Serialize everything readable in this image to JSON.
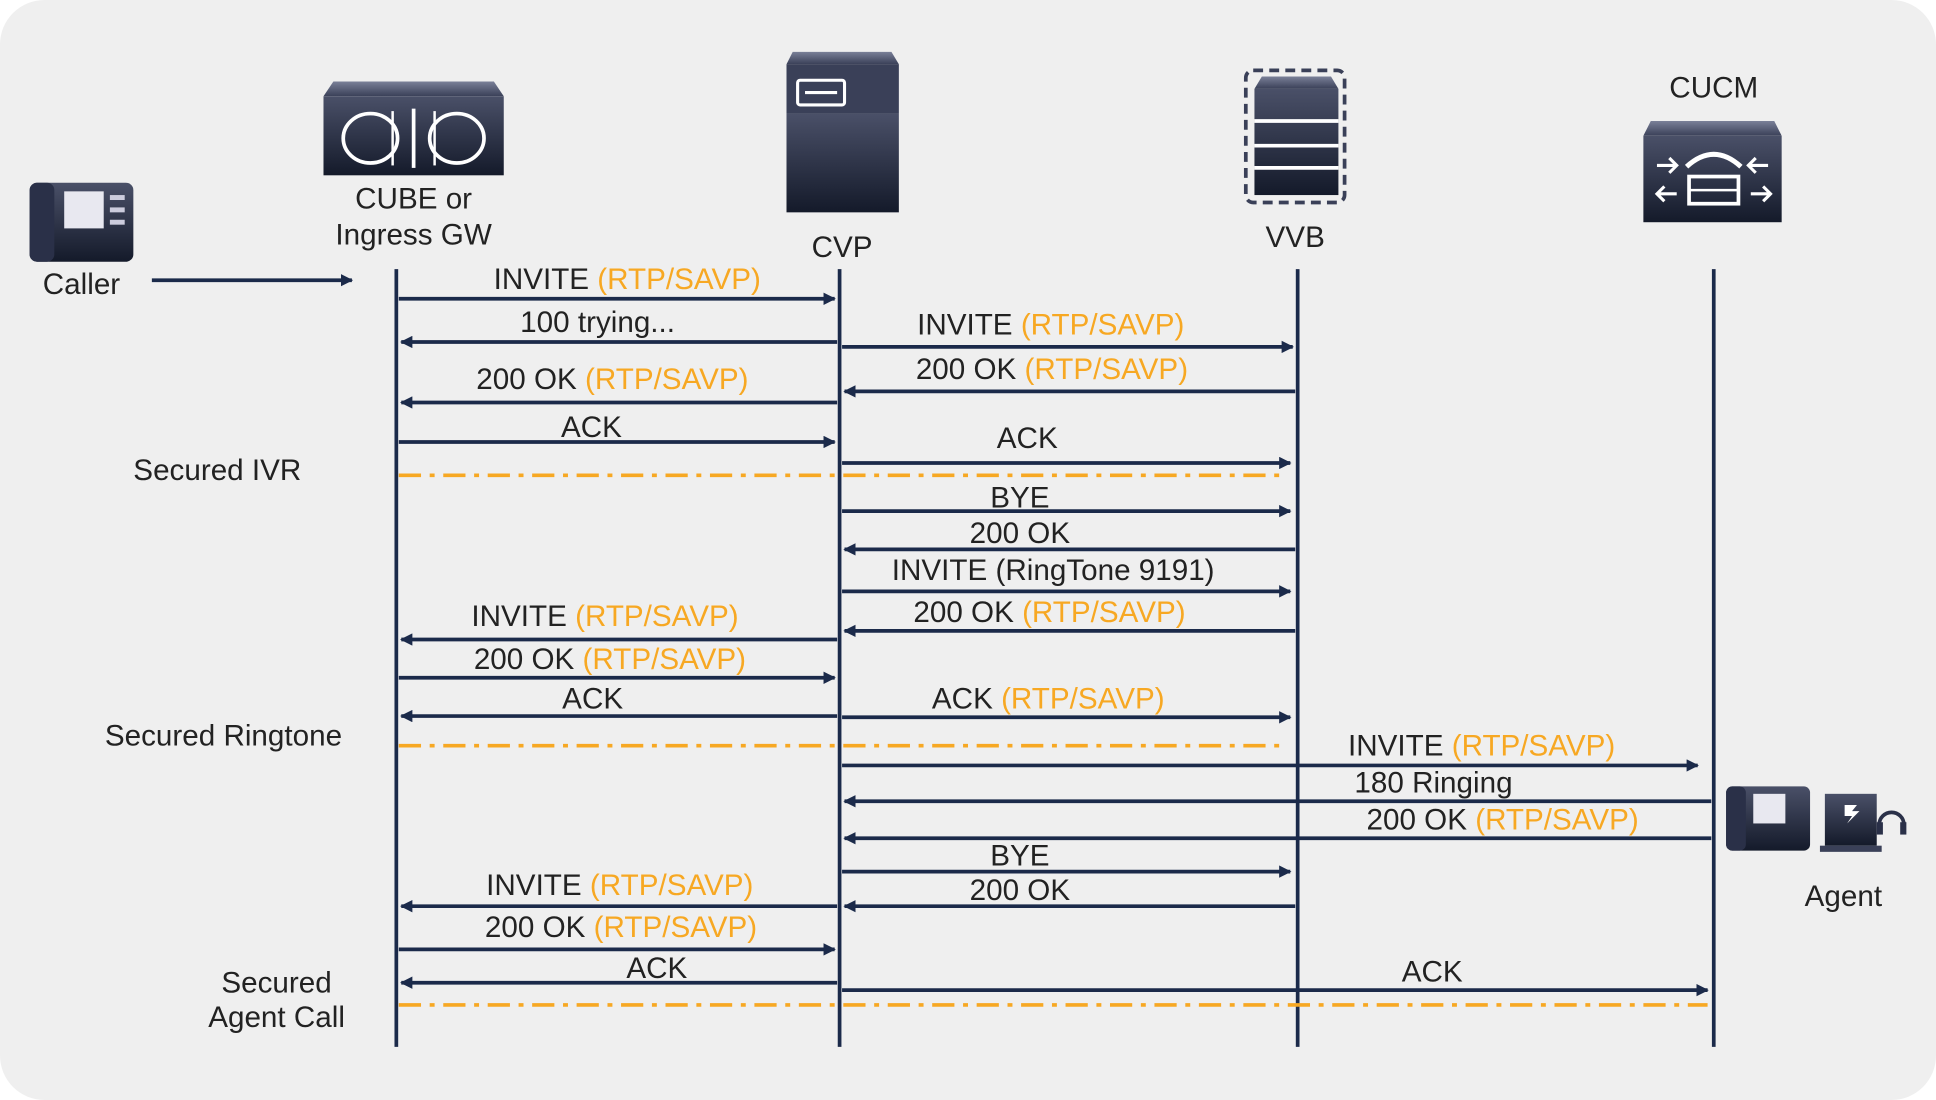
{
  "colors": {
    "background": "#efefef",
    "arrow": "#1b2a4a",
    "secure": "#f7a823",
    "text": "#222222"
  },
  "nodes": {
    "caller": "Caller",
    "cube_line1": "CUBE or",
    "cube_line2": "Ingress GW",
    "cvp": "CVP",
    "vvb": "VVB",
    "cucm": "CUCM",
    "agent": "Agent"
  },
  "sections": {
    "ivr": "Secured IVR",
    "ringtone": "Secured Ringtone",
    "agent_line1": "Secured",
    "agent_line2": "Agent Call"
  },
  "messages": [
    {
      "label": "INVITE",
      "secure": "(RTP/SAVP)",
      "from": "CUBE",
      "to": "CVP"
    },
    {
      "label": "100 trying...",
      "secure": "",
      "from": "CVP",
      "to": "CUBE"
    },
    {
      "label": "INVITE",
      "secure": "(RTP/SAVP)",
      "from": "CVP",
      "to": "VVB"
    },
    {
      "label": "200 OK",
      "secure": "(RTP/SAVP)",
      "from": "VVB",
      "to": "CVP"
    },
    {
      "label": "200 OK",
      "secure": "(RTP/SAVP)",
      "from": "CVP",
      "to": "CUBE"
    },
    {
      "label": "ACK",
      "secure": "",
      "from": "CUBE",
      "to": "CVP"
    },
    {
      "label": "ACK",
      "secure": "",
      "from": "CVP",
      "to": "VVB"
    },
    {
      "label": "BYE",
      "secure": "",
      "from": "CVP",
      "to": "VVB"
    },
    {
      "label": "200 OK",
      "secure": "",
      "from": "VVB",
      "to": "CVP"
    },
    {
      "label": "INVITE (RingTone 9191)",
      "secure": "",
      "from": "CVP",
      "to": "VVB"
    },
    {
      "label": "200 OK",
      "secure": "(RTP/SAVP)",
      "from": "VVB",
      "to": "CVP"
    },
    {
      "label": "INVITE",
      "secure": "(RTP/SAVP)",
      "from": "CVP",
      "to": "CUBE"
    },
    {
      "label": "200 OK",
      "secure": "(RTP/SAVP)",
      "from": "CUBE",
      "to": "CVP"
    },
    {
      "label": "ACK",
      "secure": "",
      "from": "CVP",
      "to": "CUBE"
    },
    {
      "label": "ACK",
      "secure": "(RTP/SAVP)",
      "from": "CVP",
      "to": "VVB"
    },
    {
      "label": "INVITE",
      "secure": "(RTP/SAVP)",
      "from": "CVP",
      "to": "CUCM"
    },
    {
      "label": "180 Ringing",
      "secure": "",
      "from": "CUCM",
      "to": "CVP"
    },
    {
      "label": "200 OK",
      "secure": "(RTP/SAVP)",
      "from": "CUCM",
      "to": "CVP"
    },
    {
      "label": "BYE",
      "secure": "",
      "from": "CVP",
      "to": "VVB"
    },
    {
      "label": "200 OK",
      "secure": "",
      "from": "VVB",
      "to": "CVP"
    },
    {
      "label": "INVITE",
      "secure": "(RTP/SAVP)",
      "from": "CVP",
      "to": "CUBE"
    },
    {
      "label": "200 OK",
      "secure": "(RTP/SAVP)",
      "from": "CUBE",
      "to": "CVP"
    },
    {
      "label": "ACK",
      "secure": "",
      "from": "CVP",
      "to": "CUBE"
    },
    {
      "label": "ACK",
      "secure": "",
      "from": "CVP",
      "to": "CUCM"
    }
  ]
}
